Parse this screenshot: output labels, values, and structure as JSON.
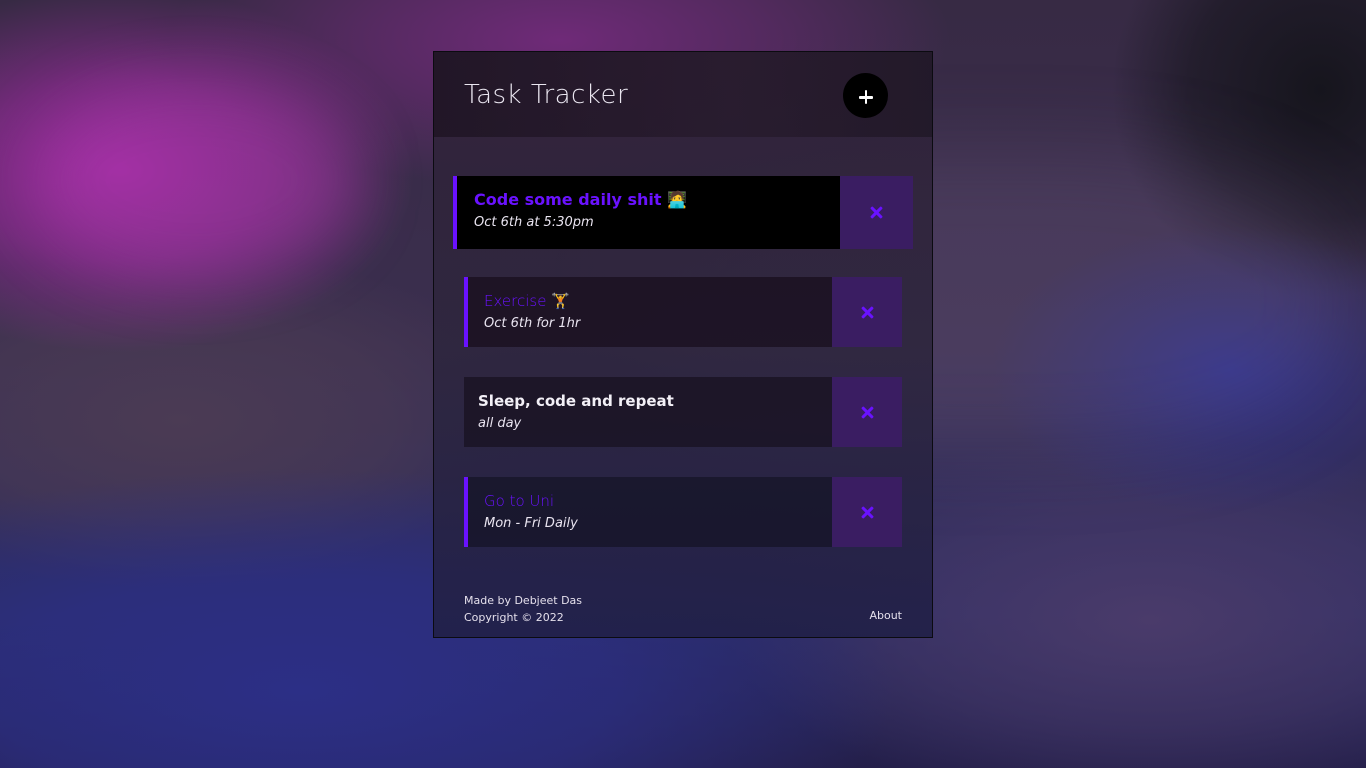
{
  "header": {
    "title": "Task Tracker",
    "add_button_icon": "plus-icon"
  },
  "tasks": [
    {
      "title": "Code some daily shit 🧑‍💻",
      "date": "Oct 6th at 5:30pm",
      "reminder": true
    },
    {
      "title": "Exercise 🏋️",
      "date": "Oct 6th for 1hr",
      "reminder": true
    },
    {
      "title": "Sleep, code and repeat",
      "date": "all day",
      "reminder": false
    },
    {
      "title": "Go to Uni",
      "date": "Mon - Fri Daily",
      "reminder": true
    }
  ],
  "footer": {
    "credit": "Made by Debjeet Das",
    "copyright": "Copyright © 2022",
    "about_link": "About"
  },
  "colors": {
    "accent": "#6a12ff",
    "delete_bg": "#3a1d62",
    "button_bg": "#000000"
  }
}
